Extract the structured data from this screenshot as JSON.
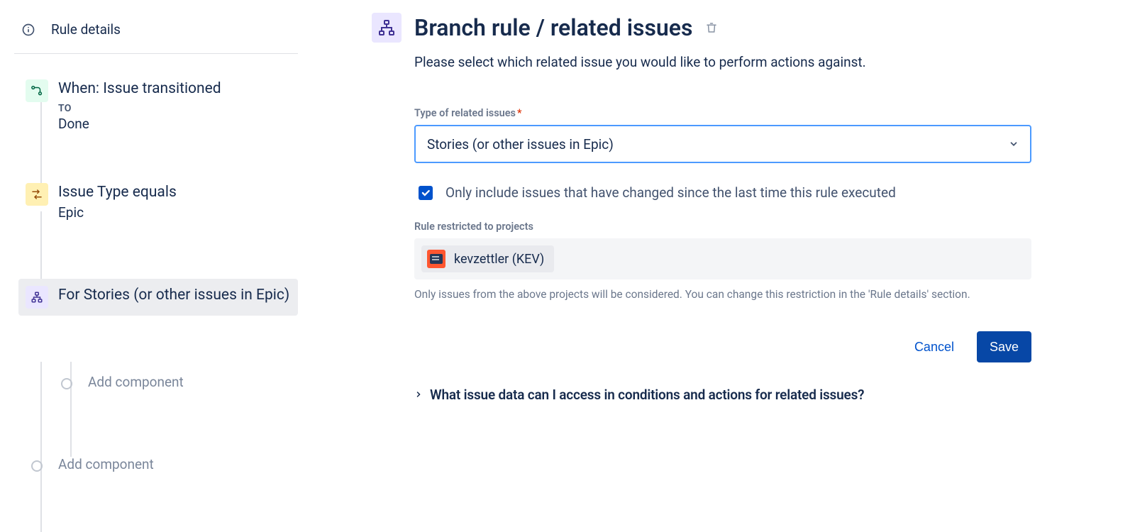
{
  "sidebar": {
    "rule_details_label": "Rule details",
    "trigger": {
      "title": "When: Issue transitioned",
      "to_label": "TO",
      "to_value": "Done"
    },
    "condition": {
      "title": "Issue Type equals",
      "value": "Epic"
    },
    "branch": {
      "title": "For Stories (or other issues in Epic)"
    },
    "add_component_inner": "Add component",
    "add_component_outer": "Add component"
  },
  "main": {
    "title": "Branch rule / related issues",
    "description": "Please select which related issue you would like to perform actions against.",
    "form": {
      "type_label": "Type of related issues",
      "type_value": "Stories (or other issues in Epic)",
      "only_changed_label": "Only include issues that have changed since the last time this rule executed",
      "restricted_label": "Rule restricted to projects",
      "project_name": "kevzettler (KEV)",
      "restricted_help": "Only issues from the above projects will be considered. You can change this restriction in the 'Rule details' section."
    },
    "buttons": {
      "cancel": "Cancel",
      "save": "Save"
    },
    "disclosure_label": "What issue data can I access in conditions and actions for related issues?"
  }
}
